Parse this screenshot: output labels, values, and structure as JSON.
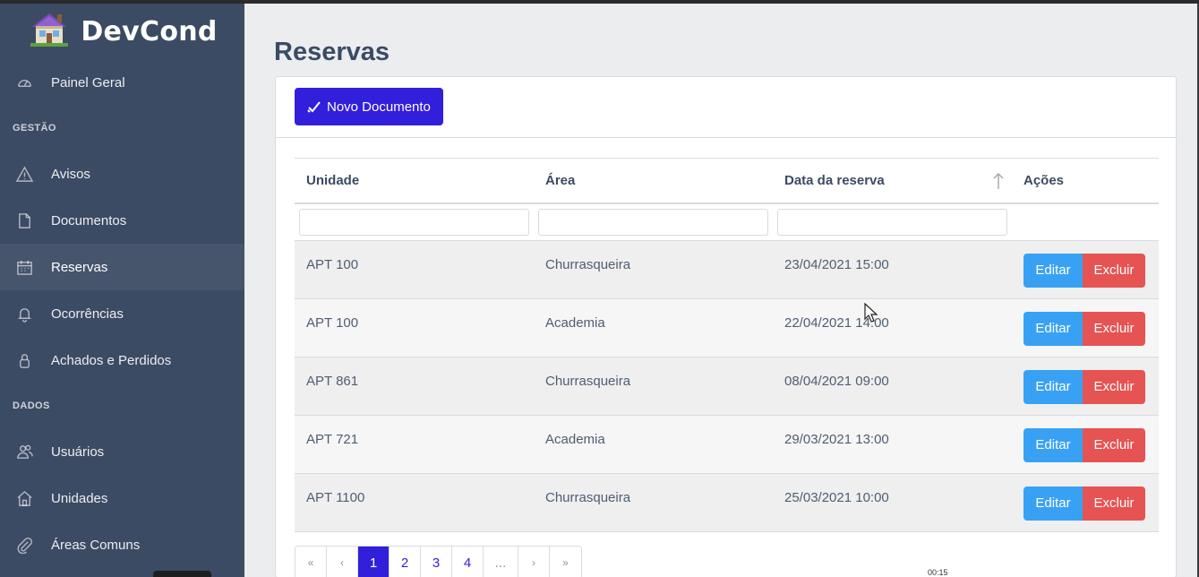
{
  "brand": {
    "name": "DevCond"
  },
  "sidebar": {
    "top_items": [
      {
        "label": "Painel Geral",
        "icon": "speedometer-icon"
      }
    ],
    "sections": [
      {
        "title": "GESTÃO",
        "items": [
          {
            "label": "Avisos",
            "icon": "warning-icon"
          },
          {
            "label": "Documentos",
            "icon": "file-icon"
          },
          {
            "label": "Reservas",
            "icon": "calendar-icon",
            "active": true
          },
          {
            "label": "Ocorrências",
            "icon": "bell-icon"
          },
          {
            "label": "Achados e Perdidos",
            "icon": "lock-icon"
          }
        ]
      },
      {
        "title": "DADOS",
        "items": [
          {
            "label": "Usuários",
            "icon": "people-icon"
          },
          {
            "label": "Unidades",
            "icon": "home-icon"
          },
          {
            "label": "Áreas Comuns",
            "icon": "paperclip-icon"
          }
        ]
      }
    ]
  },
  "page": {
    "title": "Reservas"
  },
  "toolbar": {
    "new_label": "Novo Documento"
  },
  "table": {
    "columns": [
      "Unidade",
      "Área",
      "Data da reserva",
      "Ações"
    ],
    "rows": [
      {
        "unidade": "APT 100",
        "area": "Churrasqueira",
        "data": "23/04/2021 15:00"
      },
      {
        "unidade": "APT 100",
        "area": "Academia",
        "data": "22/04/2021 14:00"
      },
      {
        "unidade": "APT 861",
        "area": "Churrasqueira",
        "data": "08/04/2021 09:00"
      },
      {
        "unidade": "APT 721",
        "area": "Academia",
        "data": "29/03/2021 13:00"
      },
      {
        "unidade": "APT 1100",
        "area": "Churrasqueira",
        "data": "25/03/2021 10:00"
      }
    ],
    "edit_label": "Editar",
    "delete_label": "Excluir"
  },
  "pagination": {
    "first": "«",
    "prev": "‹",
    "pages": [
      "1",
      "2",
      "3",
      "4"
    ],
    "active_page": "1",
    "ellipsis": "...",
    "next": "›",
    "last": "»"
  },
  "colors": {
    "sidebar": "#3c4b64",
    "primary": "#321fdb",
    "info": "#39a1f4",
    "danger": "#e55353"
  },
  "overlay": {
    "time_fragment": "00:15"
  }
}
